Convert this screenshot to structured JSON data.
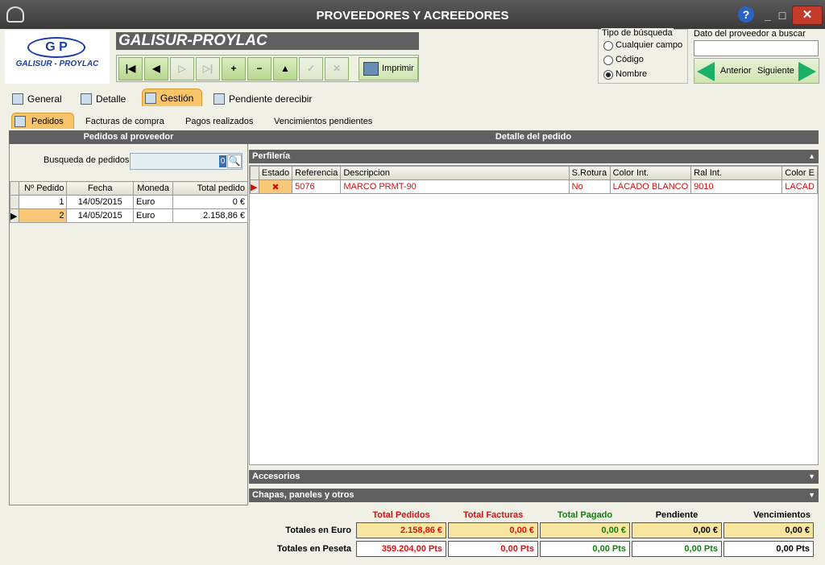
{
  "window": {
    "title": "PROVEEDORES Y ACREEDORES",
    "help": "?",
    "minimize": "_",
    "maximize": "□",
    "close": "✕"
  },
  "logo": {
    "mark": "G P",
    "name": "GALISUR - PROYLAC"
  },
  "company": "GALISUR-PROYLAC",
  "toolbar": {
    "first": "|◀",
    "prev": "◀",
    "next": "▷",
    "last": "▷|",
    "add": "+",
    "remove": "−",
    "up": "▲",
    "accept": "✓",
    "cancel": "✕",
    "print": "Imprimir"
  },
  "search": {
    "group_label": "Tipo de búsqueda",
    "options": [
      "Cualquier campo",
      "Código",
      "Nombre"
    ],
    "selected": "Nombre",
    "data_label": "Dato del proveedor a buscar",
    "data_value": "",
    "prev": "Anterior",
    "next": "Siguiente"
  },
  "main_tabs": [
    "General",
    "Detalle",
    "Gestión",
    "Pendiente derecibir"
  ],
  "active_main_tab": "Gestión",
  "sub_tabs": [
    "Pedidos",
    "Facturas de compra",
    "Pagos realizados",
    "Vencimientos pendientes"
  ],
  "active_sub_tab": "Pedidos",
  "left": {
    "header": "Pedidos al proveedor",
    "search_label": "Busqueda de pedidos",
    "search_value": "0",
    "columns": [
      "Nº Pedido",
      "Fecha",
      "Moneda",
      "Total pedido"
    ],
    "rows": [
      [
        "1",
        "14/05/2015",
        "Euro",
        "0 €"
      ],
      [
        "2",
        "14/05/2015",
        "Euro",
        "2.158,86 €"
      ]
    ]
  },
  "right": {
    "header": "Detalle del pedido",
    "section1": "Perfilería",
    "columns": [
      "Estado",
      "Referencia",
      "Descripcion",
      "S.Rotura",
      "Color Int.",
      "Ral Int.",
      "Color E"
    ],
    "rows": [
      [
        "✖",
        "5076",
        "MARCO PRMT-90",
        "No",
        "LACADO BLANCO",
        "9010",
        "LACAD"
      ]
    ],
    "section2": "Accesorios",
    "section3": "Chapas, paneles y otros"
  },
  "totals": {
    "headers": [
      "Total Pedidos",
      "Total Facturas",
      "Total Pagado",
      "Pendiente",
      "Vencimientos"
    ],
    "header_colors": [
      "#e01010",
      "#e01010",
      "#108010",
      "#000000",
      "#000000"
    ],
    "euro_label": "Totales en Euro",
    "euro": [
      "2.158,86 €",
      "0,00 €",
      "0,00 €",
      "0,00 €",
      "0,00 €"
    ],
    "peseta_label": "Totales en Peseta",
    "peseta": [
      "359.204,00 Pts",
      "0,00 Pts",
      "0,00 Pts",
      "0,00 Pts",
      "0,00 Pts"
    ]
  },
  "colors": {
    "accent_tab": "#f8c46a",
    "header_bar": "#606060",
    "arrow_green": "#1bb068"
  }
}
